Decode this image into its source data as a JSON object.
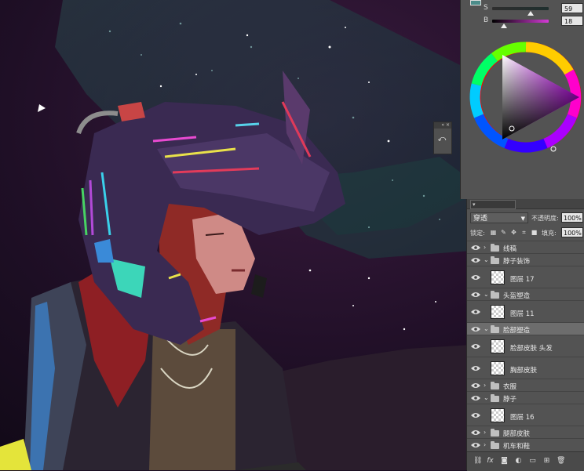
{
  "color_panel": {
    "swatch_color": "#4c8c8a",
    "saturation": {
      "label": "S",
      "value": "59",
      "level": 0.59
    },
    "brightness": {
      "label": "B",
      "value": "18",
      "level": 0.18
    },
    "wheel": "hue-ring-triangle"
  },
  "mini_panel": {
    "icon": "history-brush-icon"
  },
  "layers": {
    "blend_mode": "穿透",
    "opacity_label": "不透明度:",
    "opacity_value": "100%",
    "lock_label": "锁定:",
    "fill_label": "填充:",
    "fill_value": "100%",
    "items": [
      {
        "name": "线稿",
        "kind": "group",
        "expanded": false
      },
      {
        "name": "脖子装饰",
        "kind": "group",
        "expanded": true
      },
      {
        "name": "图层 17",
        "kind": "layer"
      },
      {
        "name": "头盔塑造",
        "kind": "group",
        "expanded": true
      },
      {
        "name": "图层 11",
        "kind": "layer"
      },
      {
        "name": "脸部塑造",
        "kind": "group",
        "expanded": true,
        "selected": true
      },
      {
        "name": "脸部皮肤  头发",
        "kind": "layer"
      },
      {
        "name": "胸部皮肤",
        "kind": "layer"
      },
      {
        "name": "衣服",
        "kind": "group",
        "expanded": false
      },
      {
        "name": "脖子",
        "kind": "group",
        "expanded": true
      },
      {
        "name": "图层 16",
        "kind": "layer"
      },
      {
        "name": "腿部皮肤",
        "kind": "group",
        "expanded": false
      },
      {
        "name": "机车和鞋",
        "kind": "group",
        "expanded": false
      }
    ],
    "bottom_icons": [
      "link-icon",
      "fx-icon",
      "mask-icon",
      "adjustment-icon",
      "new-group-icon",
      "new-layer-icon",
      "trash-icon"
    ]
  }
}
